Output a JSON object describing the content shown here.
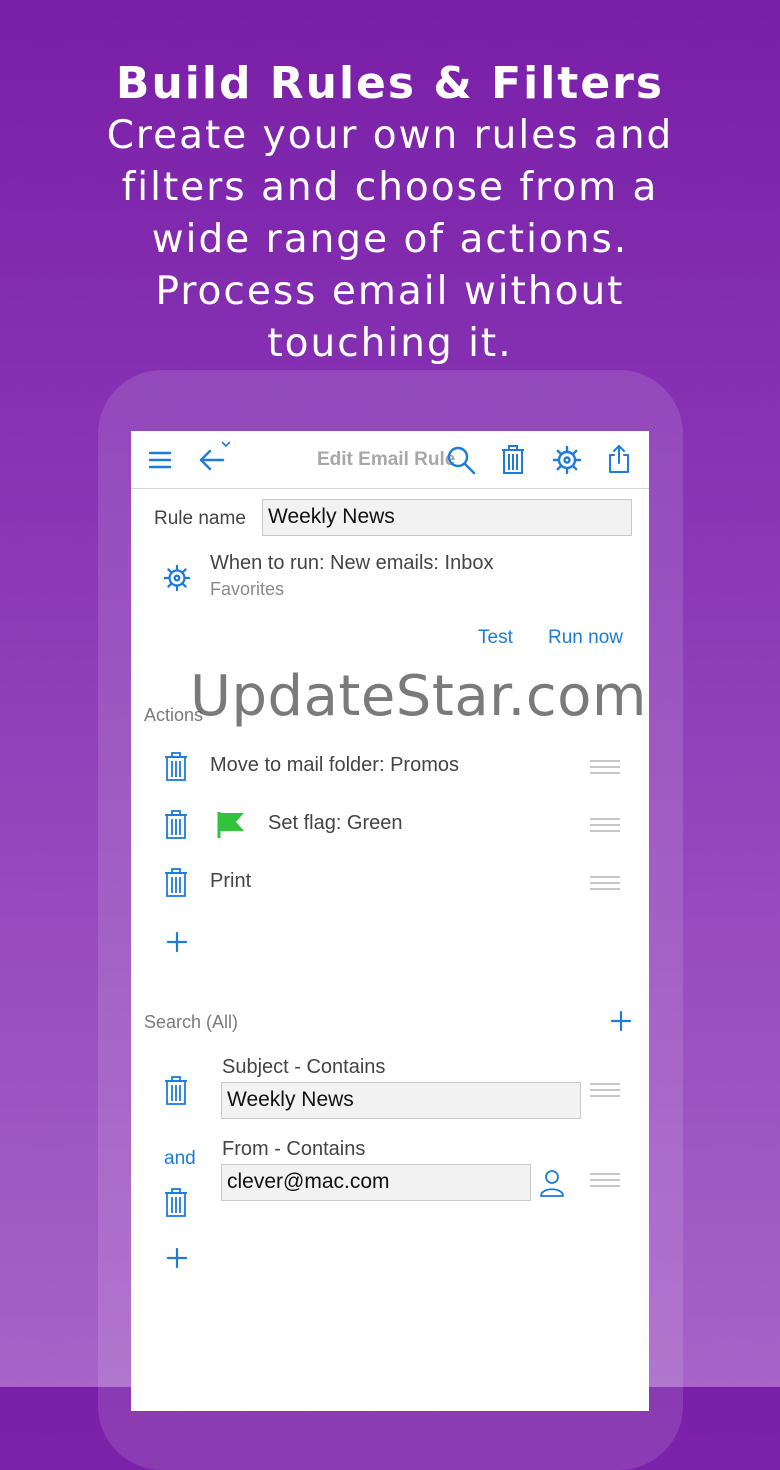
{
  "promo": {
    "title": "Build Rules & Filters",
    "lines": [
      "Create your own rules and",
      "filters and choose from a",
      "wide  range of actions.",
      "Process email without",
      "touching it."
    ]
  },
  "toolbar": {
    "title": "Edit Email Rule",
    "icons": [
      "menu-icon",
      "back-arrow-icon",
      "search-icon",
      "trash-icon",
      "gear-icon",
      "share-icon"
    ]
  },
  "rule": {
    "name_label": "Rule name",
    "name_value": "Weekly News",
    "when_to_run": "When to run: New emails: Inbox",
    "when_sub": "Favorites",
    "test_label": "Test",
    "run_now_label": "Run now"
  },
  "actions": {
    "header": "Actions",
    "items": [
      {
        "label": "Move to mail folder: Promos"
      },
      {
        "label": "Set flag: Green",
        "flag_color": "#2fc43a"
      },
      {
        "label": "Print"
      }
    ]
  },
  "search": {
    "header": "Search (All)",
    "conditions": [
      {
        "label": "Subject - Contains",
        "value": "Weekly News"
      },
      {
        "label": "From - Contains",
        "value": "clever@mac.com"
      }
    ],
    "joiner": "and"
  },
  "watermark": "UpdateStar.com",
  "colors": {
    "accent": "#1e7bd7",
    "background_top": "#7a1fa8",
    "background_bottom": "#a763c8"
  }
}
